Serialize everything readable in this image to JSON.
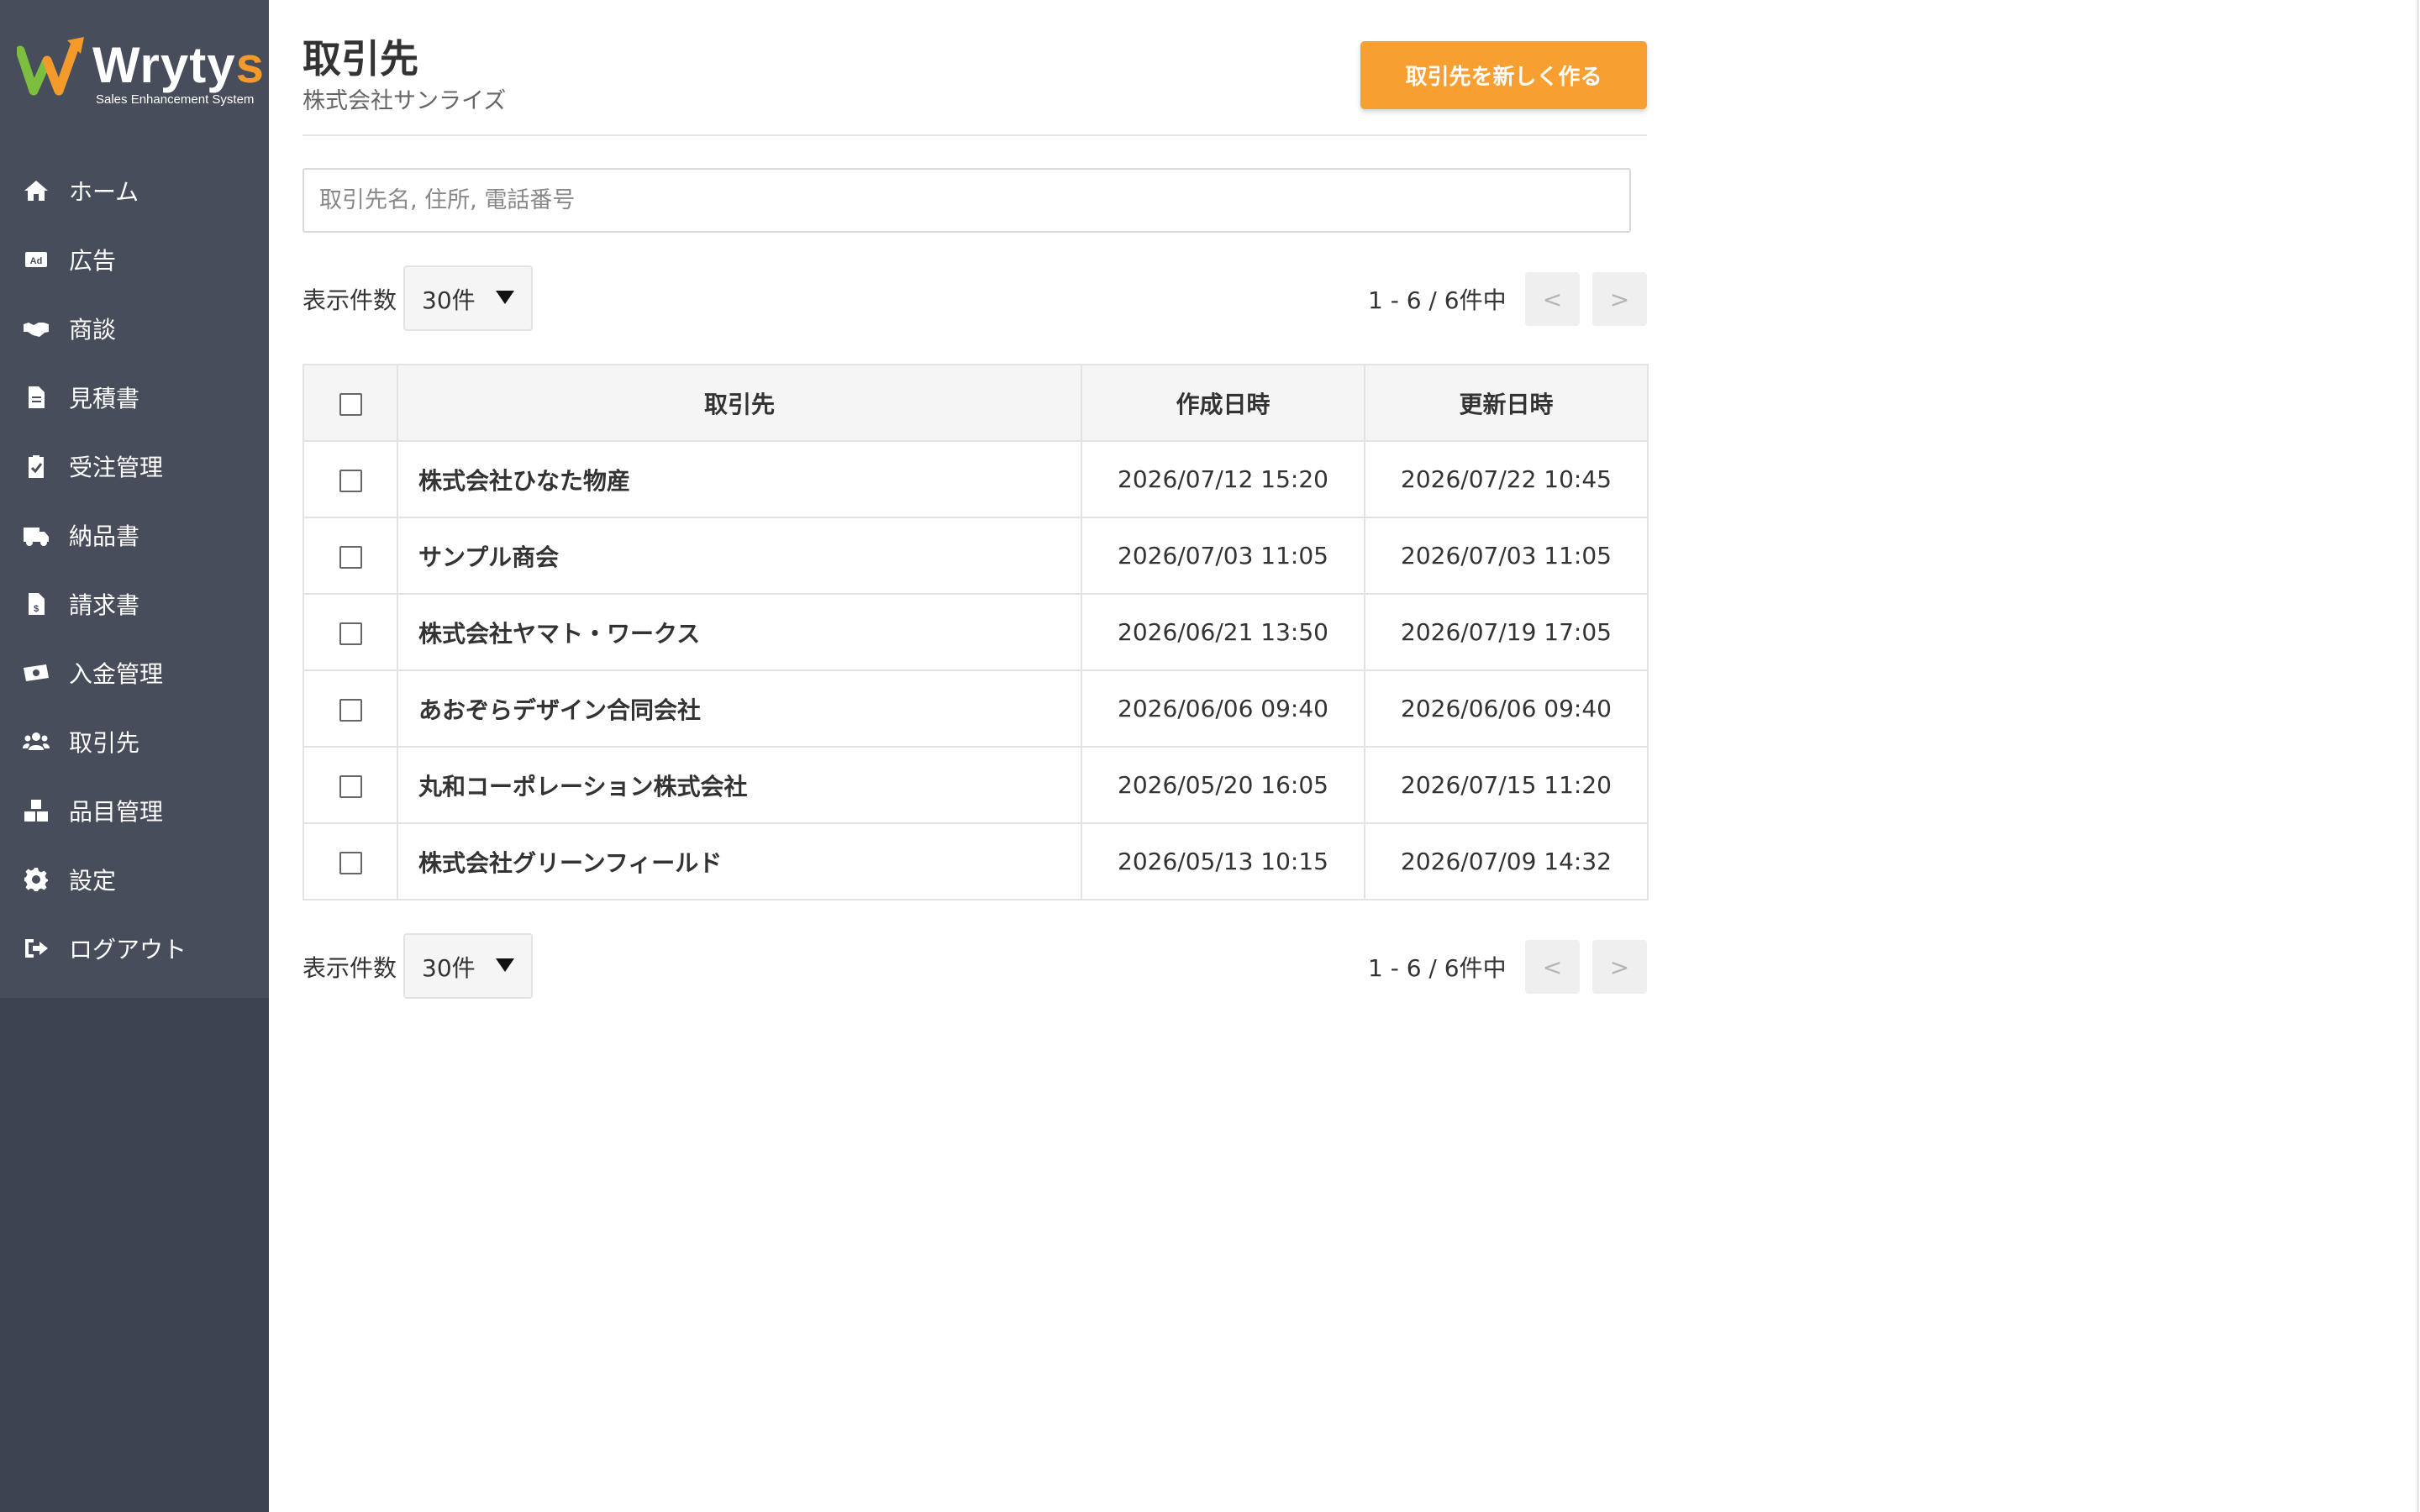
{
  "brand": {
    "name_main": "Wryty",
    "name_accent": "s",
    "tagline": "Sales Enhancement System",
    "accent_color": "#f39a2b",
    "sidebar_color": "#3d4350"
  },
  "sidebar": {
    "items": [
      {
        "label": "ホーム",
        "icon": "home-icon"
      },
      {
        "label": "広告",
        "icon": "ad-icon"
      },
      {
        "label": "商談",
        "icon": "handshake-icon"
      },
      {
        "label": "見積書",
        "icon": "document-icon"
      },
      {
        "label": "受注管理",
        "icon": "clipboard-check-icon"
      },
      {
        "label": "納品書",
        "icon": "truck-icon"
      },
      {
        "label": "請求書",
        "icon": "invoice-icon"
      },
      {
        "label": "入金管理",
        "icon": "money-icon"
      },
      {
        "label": "取引先",
        "icon": "users-icon"
      },
      {
        "label": "品目管理",
        "icon": "boxes-icon"
      },
      {
        "label": "設定",
        "icon": "gear-icon"
      },
      {
        "label": "ログアウト",
        "icon": "logout-icon"
      }
    ]
  },
  "header": {
    "title": "取引先",
    "subtitle": "株式会社サンライズ",
    "create_button": "取引先を新しく作る",
    "button_color": "#f89f32"
  },
  "search": {
    "placeholder": "取引先名, 住所, 電話番号",
    "value": ""
  },
  "pagination": {
    "per_page_label": "表示件数",
    "per_page_value": "30件",
    "range_text": "1 - 6 / 6件中",
    "prev_label": "<",
    "next_label": ">"
  },
  "table": {
    "columns": [
      "取引先",
      "作成日時",
      "更新日時"
    ],
    "rows": [
      {
        "name": "株式会社ひなた物産",
        "created": "2026/07/12 15:20",
        "updated": "2026/07/22 10:45"
      },
      {
        "name": "サンプル商会",
        "created": "2026/07/03 11:05",
        "updated": "2026/07/03 11:05"
      },
      {
        "name": "株式会社ヤマト・ワークス",
        "created": "2026/06/21 13:50",
        "updated": "2026/07/19 17:05"
      },
      {
        "name": "あおぞらデザイン合同会社",
        "created": "2026/06/06 09:40",
        "updated": "2026/06/06 09:40"
      },
      {
        "name": "丸和コーポレーション株式会社",
        "created": "2026/05/20 16:05",
        "updated": "2026/07/15 11:20"
      },
      {
        "name": "株式会社グリーンフィールド",
        "created": "2026/05/13 10:15",
        "updated": "2026/07/09 14:32"
      }
    ]
  }
}
